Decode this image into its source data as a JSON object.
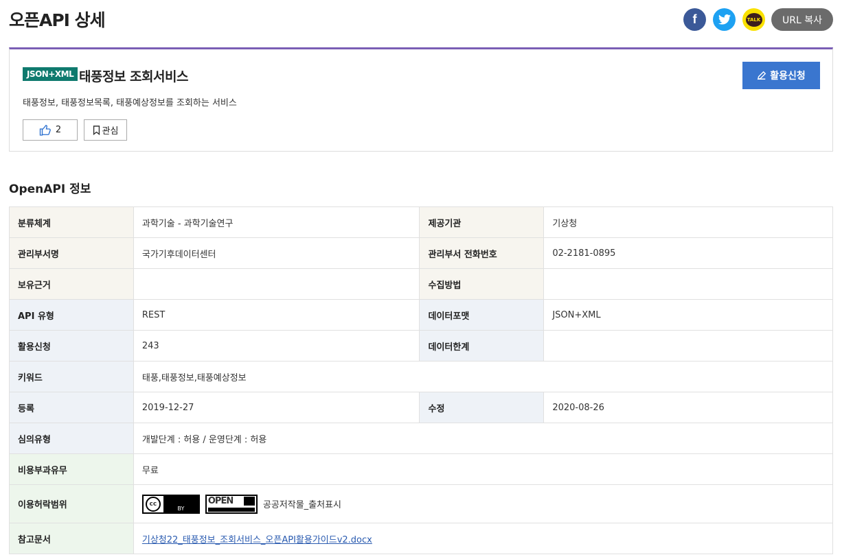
{
  "page": {
    "title": "오픈API 상세"
  },
  "share": {
    "facebook_label": "f",
    "kakao_label": "TALK",
    "url_copy_label": "URL 복사"
  },
  "summary": {
    "badge": "JSON+XML",
    "title": "태풍정보 조회서비스",
    "description": "태풍정보, 태풍정보목록, 태풍예상정보를 조회하는 서비스",
    "like_count": "2",
    "favorite_label": "관심",
    "apply_label": "활용신청"
  },
  "section": {
    "title": "OpenAPI 정보"
  },
  "info": {
    "category_label": "분류체계",
    "category_value": "과학기술 - 과학기술연구",
    "provider_label": "제공기관",
    "provider_value": "기상청",
    "dept_label": "관리부서명",
    "dept_value": "국가기후데이터센터",
    "phone_label": "관리부서 전화번호",
    "phone_value": "02-2181-0895",
    "basis_label": "보유근거",
    "basis_value": "",
    "collect_label": "수집방법",
    "collect_value": "",
    "api_type_label": "API 유형",
    "api_type_value": "REST",
    "format_label": "데이터포맷",
    "format_value": "JSON+XML",
    "apply_count_label": "활용신청",
    "apply_count_value": "243",
    "limit_label": "데이터한계",
    "limit_value": "",
    "keyword_label": "키워드",
    "keyword_value": "태풍,태풍정보,태풍예상정보",
    "registered_label": "등록",
    "registered_value": "2019-12-27",
    "modified_label": "수정",
    "modified_value": "2020-08-26",
    "review_label": "심의유형",
    "review_value": "개발단계 : 허용 / 운영단계 : 허용",
    "fee_label": "비용부과유무",
    "fee_value": "무료",
    "license_label": "이용허락범위",
    "license_value": "공공저작물_출처표시",
    "license_cc_text": "cc",
    "license_by_text": "BY",
    "license_open_text": "OPEN",
    "doc_label": "참고문서",
    "doc_value": "기상청22_태풍정보_조회서비스_오픈API활용가이드v2.docx"
  },
  "colors": {
    "accent_purple": "#7a5eb5",
    "badge_teal": "#0f7a6e",
    "apply_blue": "#3a76cf",
    "facebook": "#3b5998",
    "twitter": "#1da1f2",
    "kakao": "#fae100"
  }
}
